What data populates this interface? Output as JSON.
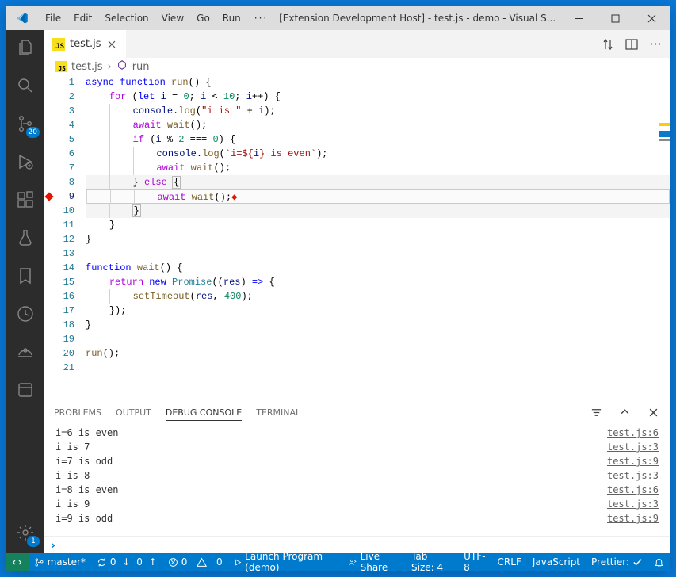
{
  "title": "[Extension Development Host] - test.js - demo - Visual S...",
  "menu": [
    "File",
    "Edit",
    "Selection",
    "View",
    "Go",
    "Run"
  ],
  "activity": {
    "scm_badge": "20",
    "settings_badge": "1"
  },
  "tab": {
    "label": "test.js"
  },
  "breadcrumbs": {
    "file": "test.js",
    "symbol": "run"
  },
  "code": {
    "lines": [
      {
        "n": 1,
        "tokens": [
          [
            "kw",
            "async "
          ],
          [
            "kw",
            "function "
          ],
          [
            "fn",
            "run"
          ],
          [
            "pl",
            "() {"
          ]
        ]
      },
      {
        "n": 2,
        "indent": 1,
        "tokens": [
          [
            "kw2",
            "for "
          ],
          [
            "pl",
            "("
          ],
          [
            "kw",
            "let "
          ],
          [
            "id",
            "i"
          ],
          [
            "pl",
            " = "
          ],
          [
            "num",
            "0"
          ],
          [
            "pl",
            "; "
          ],
          [
            "id",
            "i"
          ],
          [
            "pl",
            " < "
          ],
          [
            "num",
            "10"
          ],
          [
            "pl",
            "; "
          ],
          [
            "id",
            "i"
          ],
          [
            "pl",
            "++) {"
          ]
        ]
      },
      {
        "n": 3,
        "indent": 2,
        "tokens": [
          [
            "id",
            "console"
          ],
          [
            "pl",
            "."
          ],
          [
            "fn",
            "log"
          ],
          [
            "pl",
            "("
          ],
          [
            "str",
            "\"i is \""
          ],
          [
            "pl",
            " + "
          ],
          [
            "id",
            "i"
          ],
          [
            "pl",
            ");"
          ]
        ]
      },
      {
        "n": 4,
        "indent": 2,
        "tokens": [
          [
            "kw2",
            "await "
          ],
          [
            "fn",
            "wait"
          ],
          [
            "pl",
            "();"
          ]
        ]
      },
      {
        "n": 5,
        "indent": 2,
        "tokens": [
          [
            "kw2",
            "if "
          ],
          [
            "pl",
            "("
          ],
          [
            "id",
            "i"
          ],
          [
            "pl",
            " % "
          ],
          [
            "num",
            "2"
          ],
          [
            "pl",
            " === "
          ],
          [
            "num",
            "0"
          ],
          [
            "pl",
            ") {"
          ]
        ]
      },
      {
        "n": 6,
        "indent": 3,
        "tokens": [
          [
            "id",
            "console"
          ],
          [
            "pl",
            "."
          ],
          [
            "fn",
            "log"
          ],
          [
            "pl",
            "("
          ],
          [
            "str",
            "`i=${"
          ],
          [
            "id",
            "i"
          ],
          [
            "str",
            "} is even`"
          ],
          [
            "pl",
            ");"
          ]
        ]
      },
      {
        "n": 7,
        "indent": 3,
        "tokens": [
          [
            "kw2",
            "await "
          ],
          [
            "fn",
            "wait"
          ],
          [
            "pl",
            "();"
          ]
        ]
      },
      {
        "n": 8,
        "indent": 2,
        "hi": true,
        "tokens": [
          [
            "pl",
            "} "
          ],
          [
            "kw2",
            "else "
          ],
          [
            "pl",
            "{"
          ]
        ],
        "boxlast": true
      },
      {
        "n": 9,
        "indent": 3,
        "stop": true,
        "bp": true,
        "tokens": [
          [
            "kw2",
            "await "
          ],
          [
            "fn",
            "wait"
          ],
          [
            "pl",
            "();"
          ]
        ],
        "stopglyph": true
      },
      {
        "n": 10,
        "indent": 2,
        "hi": true,
        "tokens": [
          [
            "pl",
            "}"
          ]
        ],
        "boxfirst": true
      },
      {
        "n": 11,
        "indent": 1,
        "tokens": [
          [
            "pl",
            "}"
          ]
        ]
      },
      {
        "n": 12,
        "tokens": [
          [
            "pl",
            "}"
          ]
        ]
      },
      {
        "n": 13,
        "tokens": []
      },
      {
        "n": 14,
        "tokens": [
          [
            "kw",
            "function "
          ],
          [
            "fn",
            "wait"
          ],
          [
            "pl",
            "() {"
          ]
        ]
      },
      {
        "n": 15,
        "indent": 1,
        "tokens": [
          [
            "kw2",
            "return "
          ],
          [
            "kw",
            "new "
          ],
          [
            "cls",
            "Promise"
          ],
          [
            "pl",
            "(("
          ],
          [
            "id",
            "res"
          ],
          [
            "pl",
            ") "
          ],
          [
            "kw",
            "=>"
          ],
          [
            "pl",
            " {"
          ]
        ]
      },
      {
        "n": 16,
        "indent": 2,
        "tokens": [
          [
            "fn",
            "setTimeout"
          ],
          [
            "pl",
            "("
          ],
          [
            "id",
            "res"
          ],
          [
            "pl",
            ", "
          ],
          [
            "num",
            "400"
          ],
          [
            "pl",
            ");"
          ]
        ]
      },
      {
        "n": 17,
        "indent": 1,
        "tokens": [
          [
            "pl",
            "});"
          ]
        ]
      },
      {
        "n": 18,
        "tokens": [
          [
            "pl",
            "}"
          ]
        ]
      },
      {
        "n": 19,
        "tokens": []
      },
      {
        "n": 20,
        "tokens": [
          [
            "fn",
            "run"
          ],
          [
            "pl",
            "();"
          ]
        ]
      },
      {
        "n": 21,
        "tokens": []
      }
    ]
  },
  "panel": {
    "tabs": {
      "problems": "PROBLEMS",
      "output": "OUTPUT",
      "debug": "DEBUG CONSOLE",
      "terminal": "TERMINAL"
    },
    "rows": [
      {
        "msg": "",
        "src": ""
      },
      {
        "msg": "i=6 is even",
        "src": "test.js:6"
      },
      {
        "msg": "i is 7",
        "src": "test.js:3"
      },
      {
        "msg": "i=7 is odd",
        "src": "test.js:9"
      },
      {
        "msg": "i is 8",
        "src": "test.js:3"
      },
      {
        "msg": "i=8 is even",
        "src": "test.js:6"
      },
      {
        "msg": "i is 9",
        "src": "test.js:3"
      },
      {
        "msg": "i=9 is odd",
        "src": "test.js:9"
      }
    ]
  },
  "status": {
    "branch": "master*",
    "sync_down": "0",
    "sync_up": "0",
    "errors": "0",
    "warnings": "0",
    "launch": "Launch Program (demo)",
    "liveshare": "Live Share",
    "tabsize": "Tab Size: 4",
    "encoding": "UTF-8",
    "eol": "CRLF",
    "lang": "JavaScript",
    "prettier": "Prettier: ",
    "bell": ""
  }
}
